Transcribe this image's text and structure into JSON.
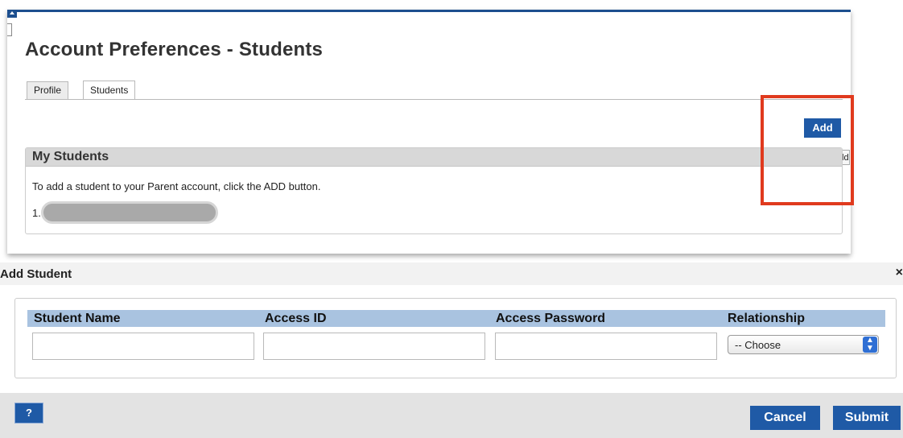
{
  "page": {
    "title": "Account Preferences - Students",
    "tabs": [
      {
        "label": "Profile",
        "active": false
      },
      {
        "label": "Students",
        "active": true
      }
    ],
    "add_button_label": "Add",
    "add_tooltip": "Add",
    "my_students": {
      "header": "My Students",
      "instruction": "To add a student to your Parent account, click the ADD button.",
      "items": [
        {
          "number": "1."
        }
      ]
    }
  },
  "dialog": {
    "title": "Add Student",
    "close_label": "×",
    "columns": {
      "student_name": "Student Name",
      "access_id": "Access ID",
      "access_password": "Access Password",
      "relationship": "Relationship"
    },
    "fields": {
      "student_name_value": "",
      "access_id_value": "",
      "access_password_value": "",
      "relationship_selected": "-- Choose"
    },
    "help_label": "?",
    "cancel_label": "Cancel",
    "submit_label": "Submit"
  },
  "icons": {
    "collapse": "collapse-arrow-icon",
    "close": "close-icon",
    "select": "select-arrows-icon"
  },
  "colors": {
    "accent": "#1f5aa6",
    "highlight": "#e03a1e",
    "column_header": "#a9c3e0"
  }
}
